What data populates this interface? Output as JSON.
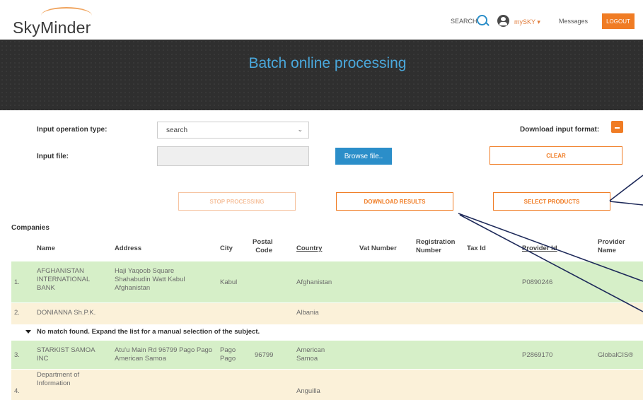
{
  "header": {
    "logo": "SkyMinder",
    "search_label": "SEARCH",
    "user_menu": "mySKY ▾",
    "messages": "Messages",
    "logout": "LOGOUT"
  },
  "banner": {
    "title": "Batch online processing"
  },
  "form": {
    "operation_label": "Input operation type:",
    "operation_value": "search",
    "file_label": "Input file:",
    "browse_button": "Browse file..",
    "download_format_label": "Download input format:",
    "clear_button": "CLEAR",
    "stop_button": "STOP PROCESSING",
    "download_results_button": "DOWNLOAD RESULTS",
    "select_products_button": "SELECT PRODUCTS"
  },
  "table": {
    "section_title": "Companies",
    "headers": {
      "name": "Name",
      "address": "Address",
      "city": "City",
      "postal": "Postal Code",
      "country": "Country",
      "vat": "Vat Number",
      "registration": "Registration Number",
      "tax": "Tax Id",
      "provider_id": "Provider Id",
      "provider_name": "Provider Name"
    },
    "rows": [
      {
        "num": "1.",
        "name": "AFGHANISTAN INTERNATIONAL BANK",
        "address": "Haji Yaqoob Square Shahabudin Watt Kabul Afghanistan",
        "city": "Kabul",
        "postal": "",
        "country": "Afghanistan",
        "provider_id": "P0890246",
        "provider_name": ""
      },
      {
        "num": "2.",
        "name": "DONIANNA Sh.P.K.",
        "address": "",
        "city": "",
        "postal": "",
        "country": "Albania",
        "provider_id": "",
        "provider_name": ""
      },
      {
        "num": "3.",
        "name": "STARKIST SAMOA INC",
        "address": "Atu'u Main Rd 96799 Pago Pago American Samoa",
        "city": "Pago Pago",
        "postal": "96799",
        "country": "American Samoa",
        "provider_id": "P2869170",
        "provider_name": "GlobalCIS®"
      },
      {
        "num": "4.",
        "name": "Department of Information",
        "address": "",
        "city": "",
        "postal": "",
        "country": "Anguilla",
        "provider_id": "",
        "provider_name": ""
      }
    ],
    "no_match_text": "No match found. Expand the list for a manual selection of the subject."
  },
  "colors": {
    "accent": "#f07c24",
    "primary": "#2b8ec9",
    "match_row": "#d6efc8",
    "nomatch_row": "#fbf1d9"
  }
}
